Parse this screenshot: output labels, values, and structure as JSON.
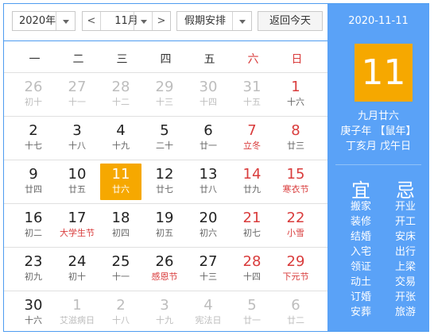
{
  "toolbar": {
    "year": "2020年",
    "prev": "<",
    "month": "11月",
    "next": ">",
    "holiday": "假期安排",
    "today": "返回今天"
  },
  "weekdays": [
    "一",
    "二",
    "三",
    "四",
    "五",
    "六",
    "日"
  ],
  "weeks": [
    [
      {
        "d": "26",
        "l": "初十",
        "s": "dim"
      },
      {
        "d": "27",
        "l": "十一",
        "s": "dim"
      },
      {
        "d": "28",
        "l": "十二",
        "s": "dim"
      },
      {
        "d": "29",
        "l": "十三",
        "s": "dim"
      },
      {
        "d": "30",
        "l": "十四",
        "s": "dim"
      },
      {
        "d": "31",
        "l": "十五",
        "s": "dim"
      },
      {
        "d": "1",
        "l": "十六",
        "s": "red"
      }
    ],
    [
      {
        "d": "2",
        "l": "十七",
        "s": ""
      },
      {
        "d": "3",
        "l": "十八",
        "s": ""
      },
      {
        "d": "4",
        "l": "十九",
        "s": ""
      },
      {
        "d": "5",
        "l": "二十",
        "s": ""
      },
      {
        "d": "6",
        "l": "廿一",
        "s": ""
      },
      {
        "d": "7",
        "l": "立冬",
        "s": "red fest"
      },
      {
        "d": "8",
        "l": "廿三",
        "s": "red"
      }
    ],
    [
      {
        "d": "9",
        "l": "廿四",
        "s": ""
      },
      {
        "d": "10",
        "l": "廿五",
        "s": ""
      },
      {
        "d": "11",
        "l": "廿六",
        "s": "sel"
      },
      {
        "d": "12",
        "l": "廿七",
        "s": ""
      },
      {
        "d": "13",
        "l": "廿八",
        "s": ""
      },
      {
        "d": "14",
        "l": "廿九",
        "s": "red"
      },
      {
        "d": "15",
        "l": "寒衣节",
        "s": "red fest"
      }
    ],
    [
      {
        "d": "16",
        "l": "初二",
        "s": ""
      },
      {
        "d": "17",
        "l": "大学生节",
        "s": "fest"
      },
      {
        "d": "18",
        "l": "初四",
        "s": ""
      },
      {
        "d": "19",
        "l": "初五",
        "s": ""
      },
      {
        "d": "20",
        "l": "初六",
        "s": ""
      },
      {
        "d": "21",
        "l": "初七",
        "s": "red"
      },
      {
        "d": "22",
        "l": "小雪",
        "s": "red fest"
      }
    ],
    [
      {
        "d": "23",
        "l": "初九",
        "s": ""
      },
      {
        "d": "24",
        "l": "初十",
        "s": ""
      },
      {
        "d": "25",
        "l": "十一",
        "s": ""
      },
      {
        "d": "26",
        "l": "感恩节",
        "s": "fest"
      },
      {
        "d": "27",
        "l": "十三",
        "s": ""
      },
      {
        "d": "28",
        "l": "十四",
        "s": "red"
      },
      {
        "d": "29",
        "l": "下元节",
        "s": "red fest"
      }
    ],
    [
      {
        "d": "30",
        "l": "十六",
        "s": ""
      },
      {
        "d": "1",
        "l": "艾滋病日",
        "s": "dim"
      },
      {
        "d": "2",
        "l": "十八",
        "s": "dim"
      },
      {
        "d": "3",
        "l": "十九",
        "s": "dim"
      },
      {
        "d": "4",
        "l": "宪法日",
        "s": "dim"
      },
      {
        "d": "5",
        "l": "廿一",
        "s": "dim"
      },
      {
        "d": "6",
        "l": "廿二",
        "s": "dim"
      }
    ]
  ],
  "panel": {
    "date": "2020-11-11",
    "day": "11",
    "lunar": "九月廿六",
    "ganzhi_year": "庚子年 【鼠年】",
    "ganzhi_month_day": "丁亥月 戊午日",
    "yi_title": "宜",
    "ji_title": "忌",
    "yi": [
      "搬家",
      "装修",
      "结婚",
      "入宅",
      "领证",
      "动土",
      "订婚",
      "安葬"
    ],
    "ji": [
      "开业",
      "开工",
      "安床",
      "出行",
      "上梁",
      "交易",
      "开张",
      "旅游"
    ]
  }
}
